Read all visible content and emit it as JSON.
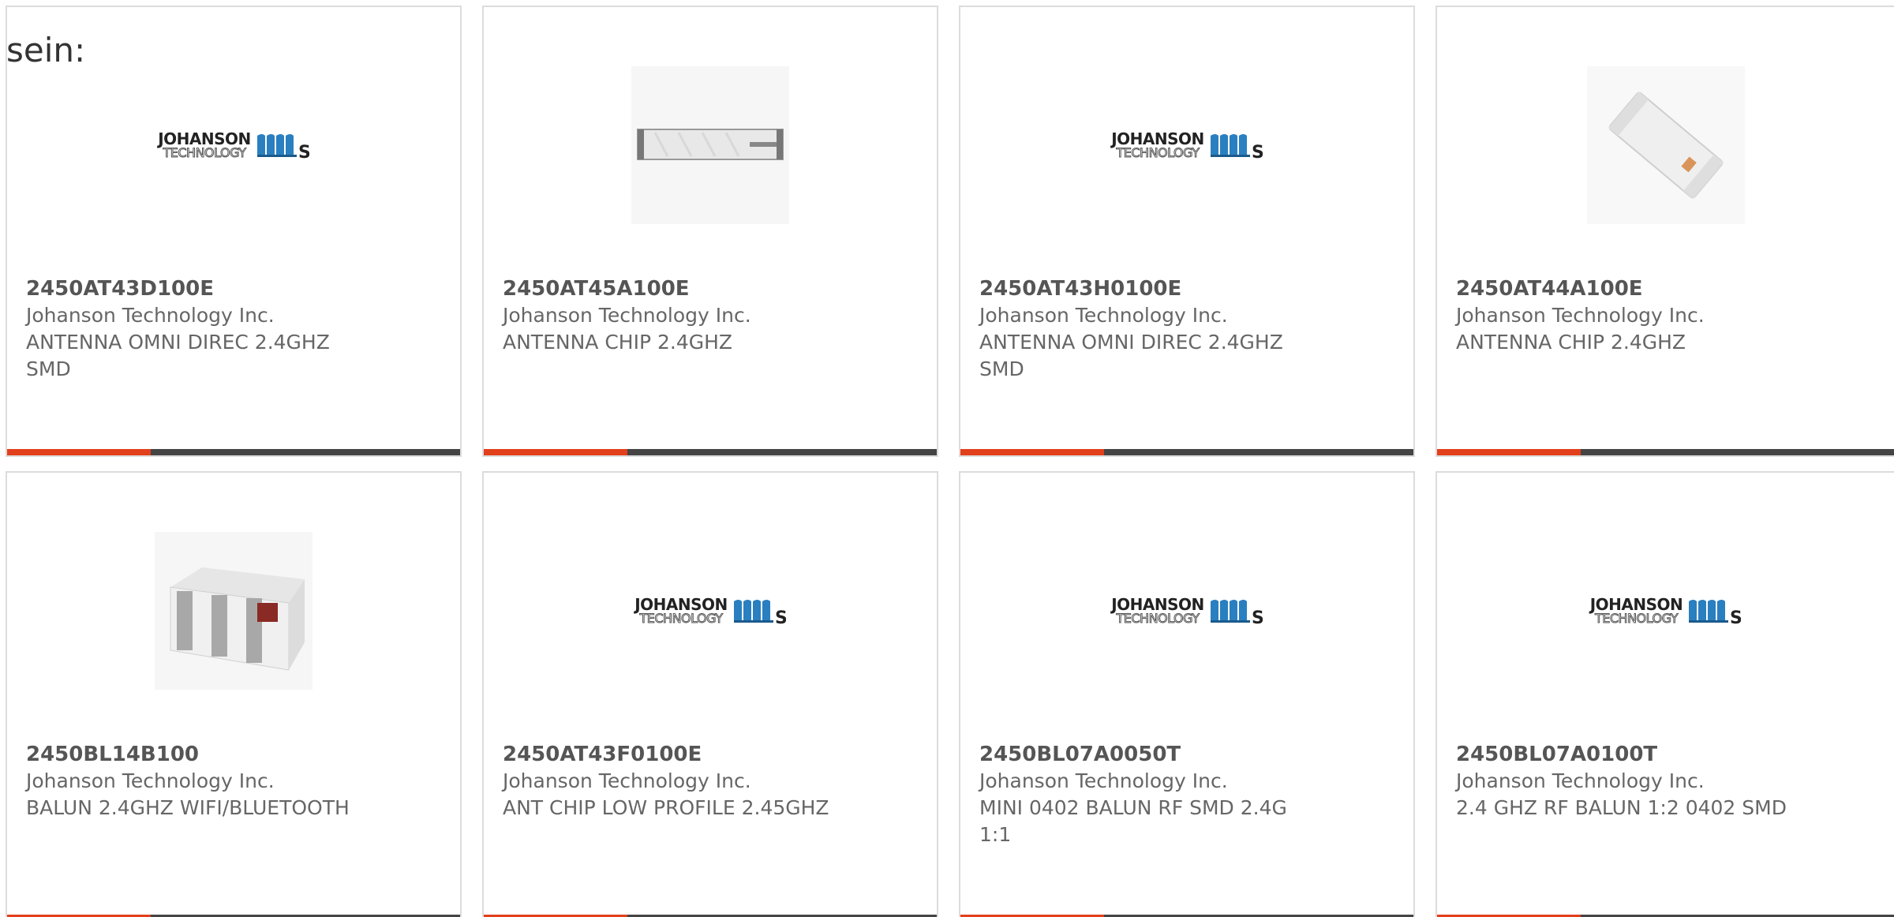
{
  "intro_text": "sein:",
  "logo": {
    "line1": "JOHANSON",
    "line2": "TECHNOLOGY",
    "icon": "johanson-wave-logo"
  },
  "colors": {
    "accent": "#e2401c",
    "bar": "#444444",
    "border": "#dcdcdc",
    "text": "#666666"
  },
  "products": [
    {
      "part_number": "2450AT43D100E",
      "manufacturer": "Johanson Technology Inc.",
      "desc_line1": "ANTENNA OMNI DIREC 2.4GHZ",
      "desc_line2": "SMD",
      "image": "manufacturer-logo"
    },
    {
      "part_number": "2450AT45A100E",
      "manufacturer": "Johanson Technology Inc.",
      "desc_line1": "ANTENNA CHIP 2.4GHZ",
      "desc_line2": "",
      "image": "chip-antenna-long"
    },
    {
      "part_number": "2450AT43H0100E",
      "manufacturer": "Johanson Technology Inc.",
      "desc_line1": "ANTENNA OMNI DIREC 2.4GHZ",
      "desc_line2": "SMD",
      "image": "manufacturer-logo"
    },
    {
      "part_number": "2450AT44A100E",
      "manufacturer": "Johanson Technology Inc.",
      "desc_line1": "ANTENNA CHIP 2.4GHZ",
      "desc_line2": "",
      "image": "chip-antenna-angled"
    },
    {
      "part_number": "2450BL14B100",
      "manufacturer": "Johanson Technology Inc.",
      "desc_line1": "BALUN 2.4GHZ WIFI/BLUETOOTH",
      "desc_line2": "",
      "image": "balun-chip"
    },
    {
      "part_number": "2450AT43F0100E",
      "manufacturer": "Johanson Technology Inc.",
      "desc_line1": "ANT CHIP LOW PROFILE 2.45GHZ",
      "desc_line2": "",
      "image": "manufacturer-logo"
    },
    {
      "part_number": "2450BL07A0050T",
      "manufacturer": "Johanson Technology Inc.",
      "desc_line1": "MINI 0402 BALUN RF SMD 2.4G",
      "desc_line2": "1:1",
      "image": "manufacturer-logo"
    },
    {
      "part_number": "2450BL07A0100T",
      "manufacturer": "Johanson Technology Inc.",
      "desc_line1": "2.4 GHZ RF BALUN 1:2 0402 SMD",
      "desc_line2": "",
      "image": "manufacturer-logo"
    }
  ]
}
